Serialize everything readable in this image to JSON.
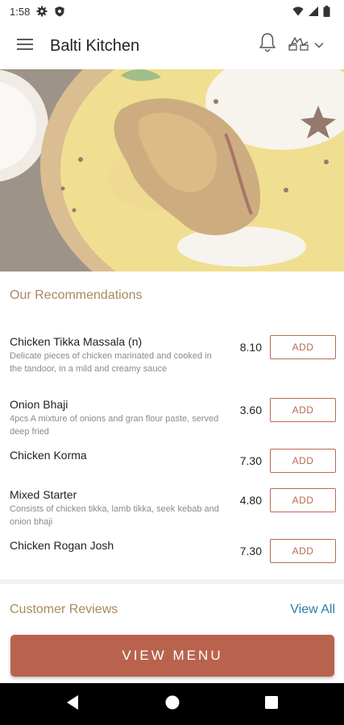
{
  "status_bar": {
    "time": "1:58"
  },
  "app_bar": {
    "title": "Balti Kitchen"
  },
  "recommendations": {
    "title": "Our Recommendations",
    "items": [
      {
        "name": "Chicken Tikka Massala (n)",
        "description": "Delicate pieces of chicken marinated and cooked in the tandoor, in a mild and creamy sauce",
        "price": "8.10",
        "add_label": "ADD"
      },
      {
        "name": "Onion Bhaji",
        "description": "4pcs A mixture of onions and gran flour paste, served deep fried",
        "price": "3.60",
        "add_label": "ADD"
      },
      {
        "name": "Chicken Korma",
        "description": "",
        "price": "7.30",
        "add_label": "ADD"
      },
      {
        "name": "Mixed Starter",
        "description": "Consists of chicken tikka, lamb tikka, seek kebab and onion bhaji",
        "price": "4.80",
        "add_label": "ADD"
      },
      {
        "name": "Chicken Rogan Josh",
        "description": "",
        "price": "7.30",
        "add_label": "ADD"
      }
    ]
  },
  "reviews": {
    "title": "Customer Reviews",
    "view_all": "View All"
  },
  "view_menu_button": "VIEW MENU",
  "colors": {
    "accent": "#b9634e",
    "gold": "#a88a5c",
    "link": "#2a7fa6"
  },
  "icons": [
    "settings-icon",
    "shield-icon",
    "wifi-icon",
    "signal-icon",
    "battery-icon",
    "menu-icon",
    "bell-icon",
    "language-icon",
    "chevron-down-icon",
    "back-icon",
    "home-icon",
    "recents-icon"
  ]
}
